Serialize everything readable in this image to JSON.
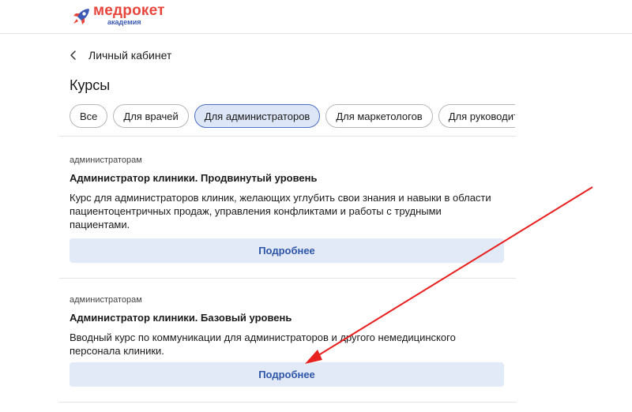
{
  "brand": {
    "name": "медрокет",
    "subtitle": "академия",
    "accent_color": "#e8453c",
    "secondary_color": "#3b5bb5"
  },
  "nav": {
    "back_label": "Личный кабинет",
    "back_icon": "chevron-left-icon"
  },
  "page": {
    "title": "Курсы"
  },
  "tabs": [
    {
      "label": "Все",
      "active": false
    },
    {
      "label": "Для врачей",
      "active": false
    },
    {
      "label": "Для администраторов",
      "active": true
    },
    {
      "label": "Для маркетологов",
      "active": false
    },
    {
      "label": "Для руководителей",
      "active": false
    }
  ],
  "courses": [
    {
      "tag": "администраторам",
      "title": "Администратор клиники. Продвинутый уровень",
      "description": "Курс для администраторов клиник, желающих углубить свои знания и навыки в области пациентоцентричных продаж, управления конфликтами и работы с трудными пациентами.",
      "button_label": "Подробнее"
    },
    {
      "tag": "администраторам",
      "title": "Администратор клиники. Базовый уровень",
      "description": "Вводный курс по коммуникации для администраторов и другого немедицинского персонала клиники.",
      "button_label": "Подробнее"
    }
  ],
  "colors": {
    "active_tab_bg": "#dde6f6",
    "active_tab_border": "#4a6fc4",
    "button_bg": "#e3eaf7",
    "button_text": "#2d55a8",
    "annotation_arrow": "#e8201e"
  }
}
